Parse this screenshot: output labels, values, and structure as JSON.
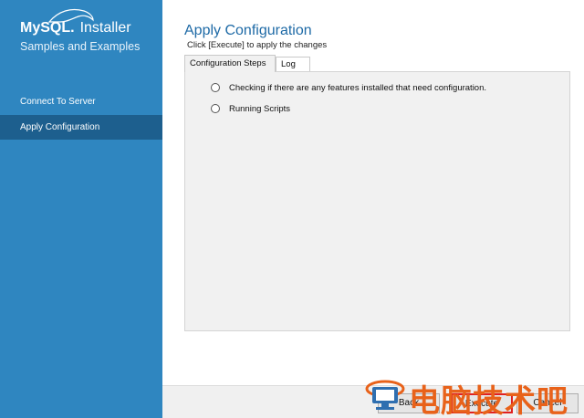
{
  "sidebar": {
    "logo": {
      "brand": "MySQL.",
      "product": "Installer",
      "subtitle": "Samples and Examples"
    },
    "items": [
      {
        "label": "Connect To Server",
        "active": false
      },
      {
        "label": "Apply Configuration",
        "active": true
      }
    ]
  },
  "main": {
    "title": "Apply Configuration",
    "subtitle": "Click [Execute] to apply the changes",
    "tabs": [
      {
        "label": "Configuration Steps",
        "active": true
      },
      {
        "label": "Log",
        "active": false
      }
    ],
    "steps": [
      {
        "label": "Checking if there are any features installed that need configuration."
      },
      {
        "label": "Running Scripts"
      }
    ]
  },
  "footer": {
    "back_label": "Back",
    "execute_label": "Execute",
    "cancel_label": "Cancel"
  },
  "watermark": {
    "text": "电脑技术吧"
  },
  "colors": {
    "sidebar_bg": "#2f86c0",
    "sidebar_active": "#1d5f8e",
    "title": "#1e6aa6",
    "highlight": "#e02020",
    "watermark": "#e8621a"
  }
}
